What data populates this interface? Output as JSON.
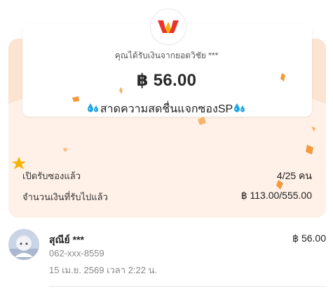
{
  "envelope": {
    "sender_text": "คุณได้รับเงินจากยอดวิชัย ***",
    "amount": "฿ 56.00",
    "message": "สาดความสดชื่นแจกซองSP"
  },
  "stats": {
    "opened_label": "เปิดรับซองแล้ว",
    "opened_value": "4/25 คน",
    "received_label": "จำนวนเงินที่รับไปแล้ว",
    "received_value": "฿ 113.00/555.00"
  },
  "recipients": [
    {
      "name": "สุณีย์ ***",
      "phone": "062-xxx-8559",
      "date": "15 เม.ย. 2569 เวลา 2:22 น.",
      "amount": "฿ 56.00"
    }
  ],
  "colors": {
    "envelope_top": "#fde3d2",
    "envelope_bottom": "#fff1e8",
    "logo_red": "#e8342b",
    "logo_yellow": "#f5b400",
    "confetti": "#f39a3c",
    "drop_blue": "#1aa5e6"
  },
  "icons": {
    "logo": "wallet-w-logo",
    "message_decoration": "water-drop-icon"
  }
}
